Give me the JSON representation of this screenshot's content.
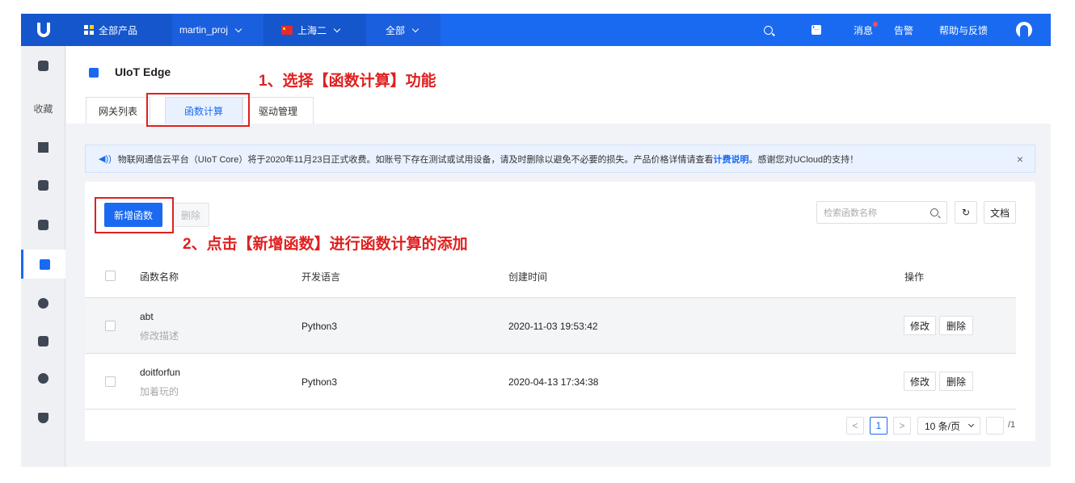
{
  "topbar": {
    "all_products": "全部产品",
    "project": "martin_proj",
    "region": "上海二",
    "zone": "全部",
    "messages": "消息",
    "alarms": "告警",
    "help": "帮助与反馈"
  },
  "sidebar": {
    "favorites": "收藏"
  },
  "header": {
    "title": "UIoT Edge",
    "tabs": [
      "网关列表",
      "函数计算",
      "驱动管理"
    ]
  },
  "annotations": {
    "step1": "1、选择【函数计算】功能",
    "step2": "2、点击【新增函数】进行函数计算的添加"
  },
  "notice": {
    "text": "物联网通信云平台（UIoT Core）将于2020年11月23日正式收费。如账号下存在测试或试用设备，请及时删除以避免不必要的损失。产品价格详情请查看",
    "link": "计费说明",
    "suffix": "。感谢您对UCloud的支持！",
    "close": "×"
  },
  "toolbar": {
    "add_label": "新增函数",
    "delete_label": "删除",
    "search_placeholder": "检索函数名称",
    "docs_label": "文档"
  },
  "table": {
    "headers": [
      "函数名称",
      "开发语言",
      "创建时间",
      "操作"
    ],
    "rows": [
      {
        "name": "abt",
        "desc": "修改描述",
        "language": "Python3",
        "created": "2020-11-03 19:53:42",
        "edit": "修改",
        "delete": "删除"
      },
      {
        "name": "doitforfun",
        "desc": "加着玩的",
        "language": "Python3",
        "created": "2020-04-13 17:34:38",
        "edit": "修改",
        "delete": "删除"
      }
    ]
  },
  "pagination": {
    "prev": "<",
    "current": "1",
    "next": ">",
    "page_size": "10 条/页",
    "total": "/1"
  },
  "colors": {
    "brand": "#1a6af1",
    "annotation": "#e02020"
  }
}
